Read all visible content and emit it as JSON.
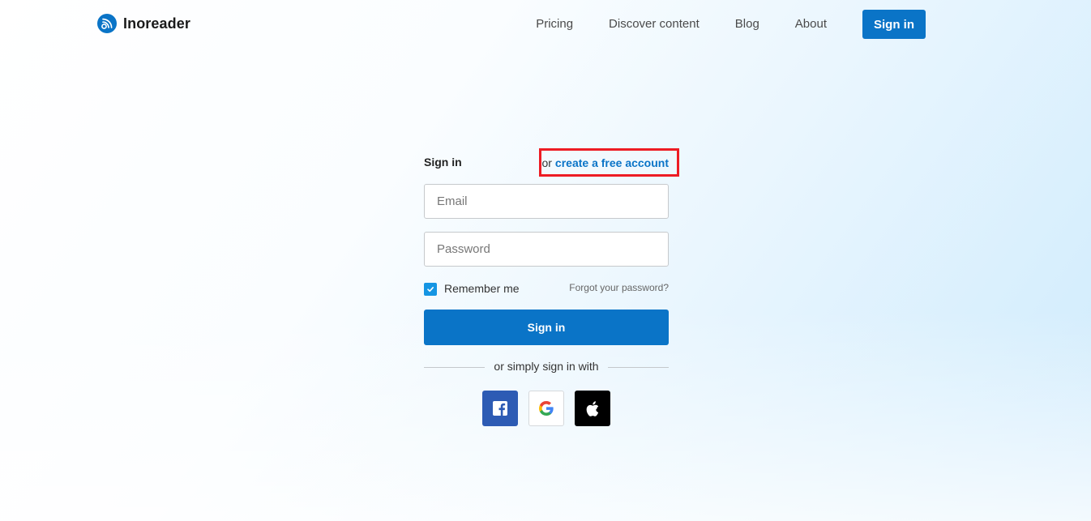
{
  "brand": {
    "name": "Inoreader",
    "logo_icon": "rss-signal-icon",
    "accent": "#0a74c7"
  },
  "nav": {
    "items": [
      "Pricing",
      "Discover content",
      "Blog",
      "About"
    ],
    "signin_label": "Sign in"
  },
  "form": {
    "title": "Sign in",
    "create_prefix": "or",
    "create_link": "create a free account",
    "email_placeholder": "Email",
    "password_placeholder": "Password",
    "remember_label": "Remember me",
    "remember_checked": true,
    "forgot_label": "Forgot your password?",
    "submit_label": "Sign in",
    "divider_text": "or simply sign in with",
    "socials": [
      "facebook-icon",
      "google-icon",
      "apple-icon"
    ]
  },
  "highlight_color": "#ed1c24"
}
